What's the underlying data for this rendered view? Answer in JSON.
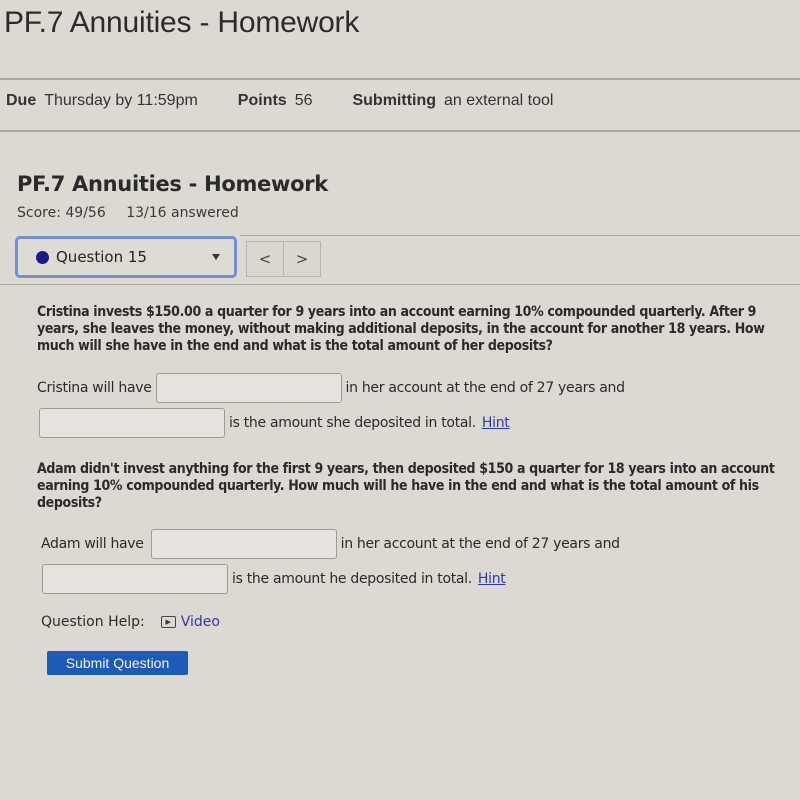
{
  "page": {
    "title": "PF.7 Annuities - Homework",
    "meta": {
      "due_label": "Due",
      "due_value": "Thursday by 11:59pm",
      "points_label": "Points",
      "points_value": "56",
      "submitting_label": "Submitting",
      "submitting_value": "an external tool"
    }
  },
  "assignment": {
    "title": "PF.7 Annuities - Homework",
    "score": "Score: 49/56",
    "answered": "13/16 answered",
    "question_selector": {
      "selected": "Question 15",
      "status_color": "#1a1a8c"
    },
    "nav": {
      "prev": "<",
      "next": ">"
    }
  },
  "question": {
    "part1": {
      "text": "Cristina invests $150.00 a quarter for 9 years into an account earning 10% compounded quarterly. After 9 years, she leaves the money, without making additional deposits, in the account for another 18 years. How much will she have in the end and what is the total amount of her deposits?",
      "prefix": "Cristina will have",
      "answer1_value": "",
      "middle": "in her account at the end of 27 years and",
      "answer2_value": "",
      "suffix": "is the amount she deposited in total.",
      "hint": "Hint"
    },
    "part2": {
      "text": "Adam didn't invest anything for the first 9 years, then deposited $150 a quarter for 18 years into an account earning 10% compounded quarterly. How much will he have in the end and what is the total amount of his deposits?",
      "prefix": "Adam will have",
      "answer1_value": "",
      "middle": "in her account at the end of 27 years and",
      "answer2_value": "",
      "suffix": "is the amount he deposited in total.",
      "hint": "Hint"
    },
    "help_label": "Question Help:",
    "video_label": "Video",
    "submit_label": "Submit Question"
  }
}
